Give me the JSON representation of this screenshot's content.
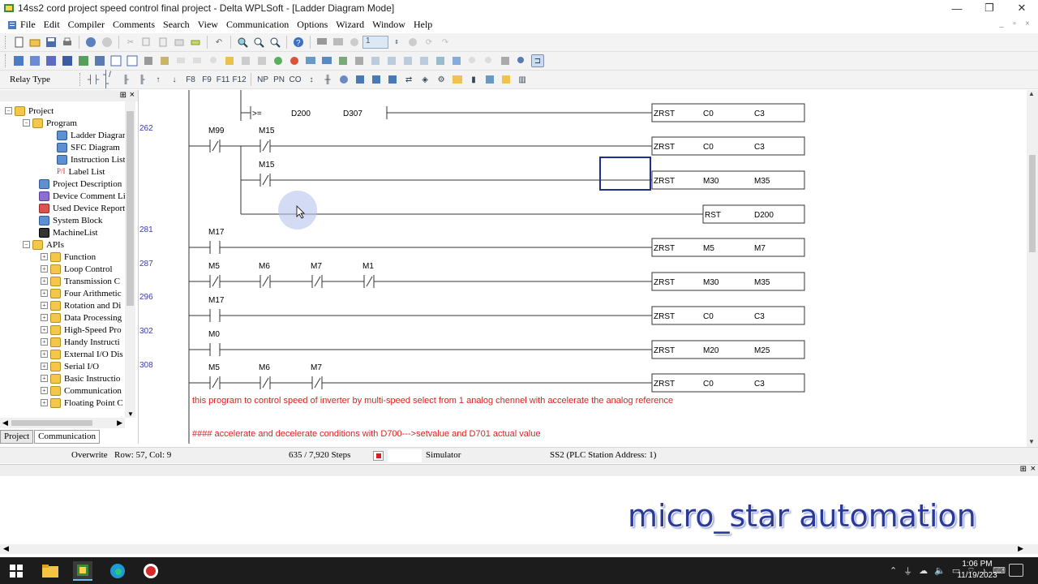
{
  "window": {
    "title": "14ss2 cord project speed control final project - Delta WPLSoft - [Ladder Diagram Mode]",
    "min_glyph": "—",
    "max_glyph": "❐",
    "close_glyph": "✕"
  },
  "menu": [
    "File",
    "Edit",
    "Compiler",
    "Comments",
    "Search",
    "View",
    "Communication",
    "Options",
    "Wizard",
    "Window",
    "Help"
  ],
  "toolbar": {
    "relay_type_label": "Relay Type",
    "step_value": "1"
  },
  "project_tree": {
    "root": "Project",
    "program": "Program",
    "program_items": [
      "Ladder Diagram",
      "SFC Diagram",
      "Instruction List",
      "Label List"
    ],
    "items": [
      "Project Description",
      "Device Comment List",
      "Used Device Report",
      "System Block",
      "MachineList"
    ],
    "apis": "APIs",
    "api_items": [
      "Function",
      "Loop Control",
      "Transmission C",
      "Four Arithmetic",
      "Rotation and Di",
      "Data Processing",
      "High-Speed Pro",
      "Handy Instructi",
      "External I/O Dis",
      "Serial I/O",
      "Basic Instructio",
      "Communication",
      "Floating Point C"
    ],
    "tabs": [
      "Project",
      "Communication"
    ]
  },
  "ladder": {
    "steps": [
      "262",
      "281",
      "287",
      "296",
      "302",
      "308"
    ],
    "compare": {
      "op": ">=",
      "a": "D200",
      "b": "D307"
    },
    "rungs": [
      {
        "contacts": [
          ">="
        ],
        "instr": "ZRST",
        "op1": "C0",
        "op2": "C3"
      },
      {
        "contacts": [
          "M99",
          "M15"
        ],
        "instr": "ZRST",
        "op1": "C0",
        "op2": "C3"
      },
      {
        "contacts": [
          "M15"
        ],
        "instr": "ZRST",
        "op1": "M30",
        "op2": "M35"
      },
      {
        "contacts": [],
        "instr": "RST",
        "op1": "D200",
        "op2": ""
      },
      {
        "contacts": [
          "M17"
        ],
        "instr": "ZRST",
        "op1": "M5",
        "op2": "M7"
      },
      {
        "contacts": [
          "M5",
          "M6",
          "M7",
          "M1"
        ],
        "instr": "ZRST",
        "op1": "M30",
        "op2": "M35"
      },
      {
        "contacts": [
          "M17"
        ],
        "instr": "ZRST",
        "op1": "C0",
        "op2": "C3"
      },
      {
        "contacts": [
          "M0"
        ],
        "instr": "ZRST",
        "op1": "M20",
        "op2": "M25"
      },
      {
        "contacts": [
          "M5",
          "M6",
          "M7"
        ],
        "instr": "ZRST",
        "op1": "C0",
        "op2": "C3"
      }
    ],
    "comment1": "this program to control speed of inverter by multi-speed select from 1 analog chennel with accelerate the analog reference",
    "comment2": "#### accelerate and decelerate conditions with D700--->setvalue and D701 actual value"
  },
  "status": {
    "mode": "Overwrite",
    "position": "Row: 57, Col: 9",
    "steps": "635 / 7,920 Steps",
    "simulator": "Simulator",
    "station": "SS2 (PLC Station Address: 1)"
  },
  "watermark": "micro_star automation",
  "clock": {
    "time": "1:06 PM",
    "date": "11/19/2023"
  }
}
